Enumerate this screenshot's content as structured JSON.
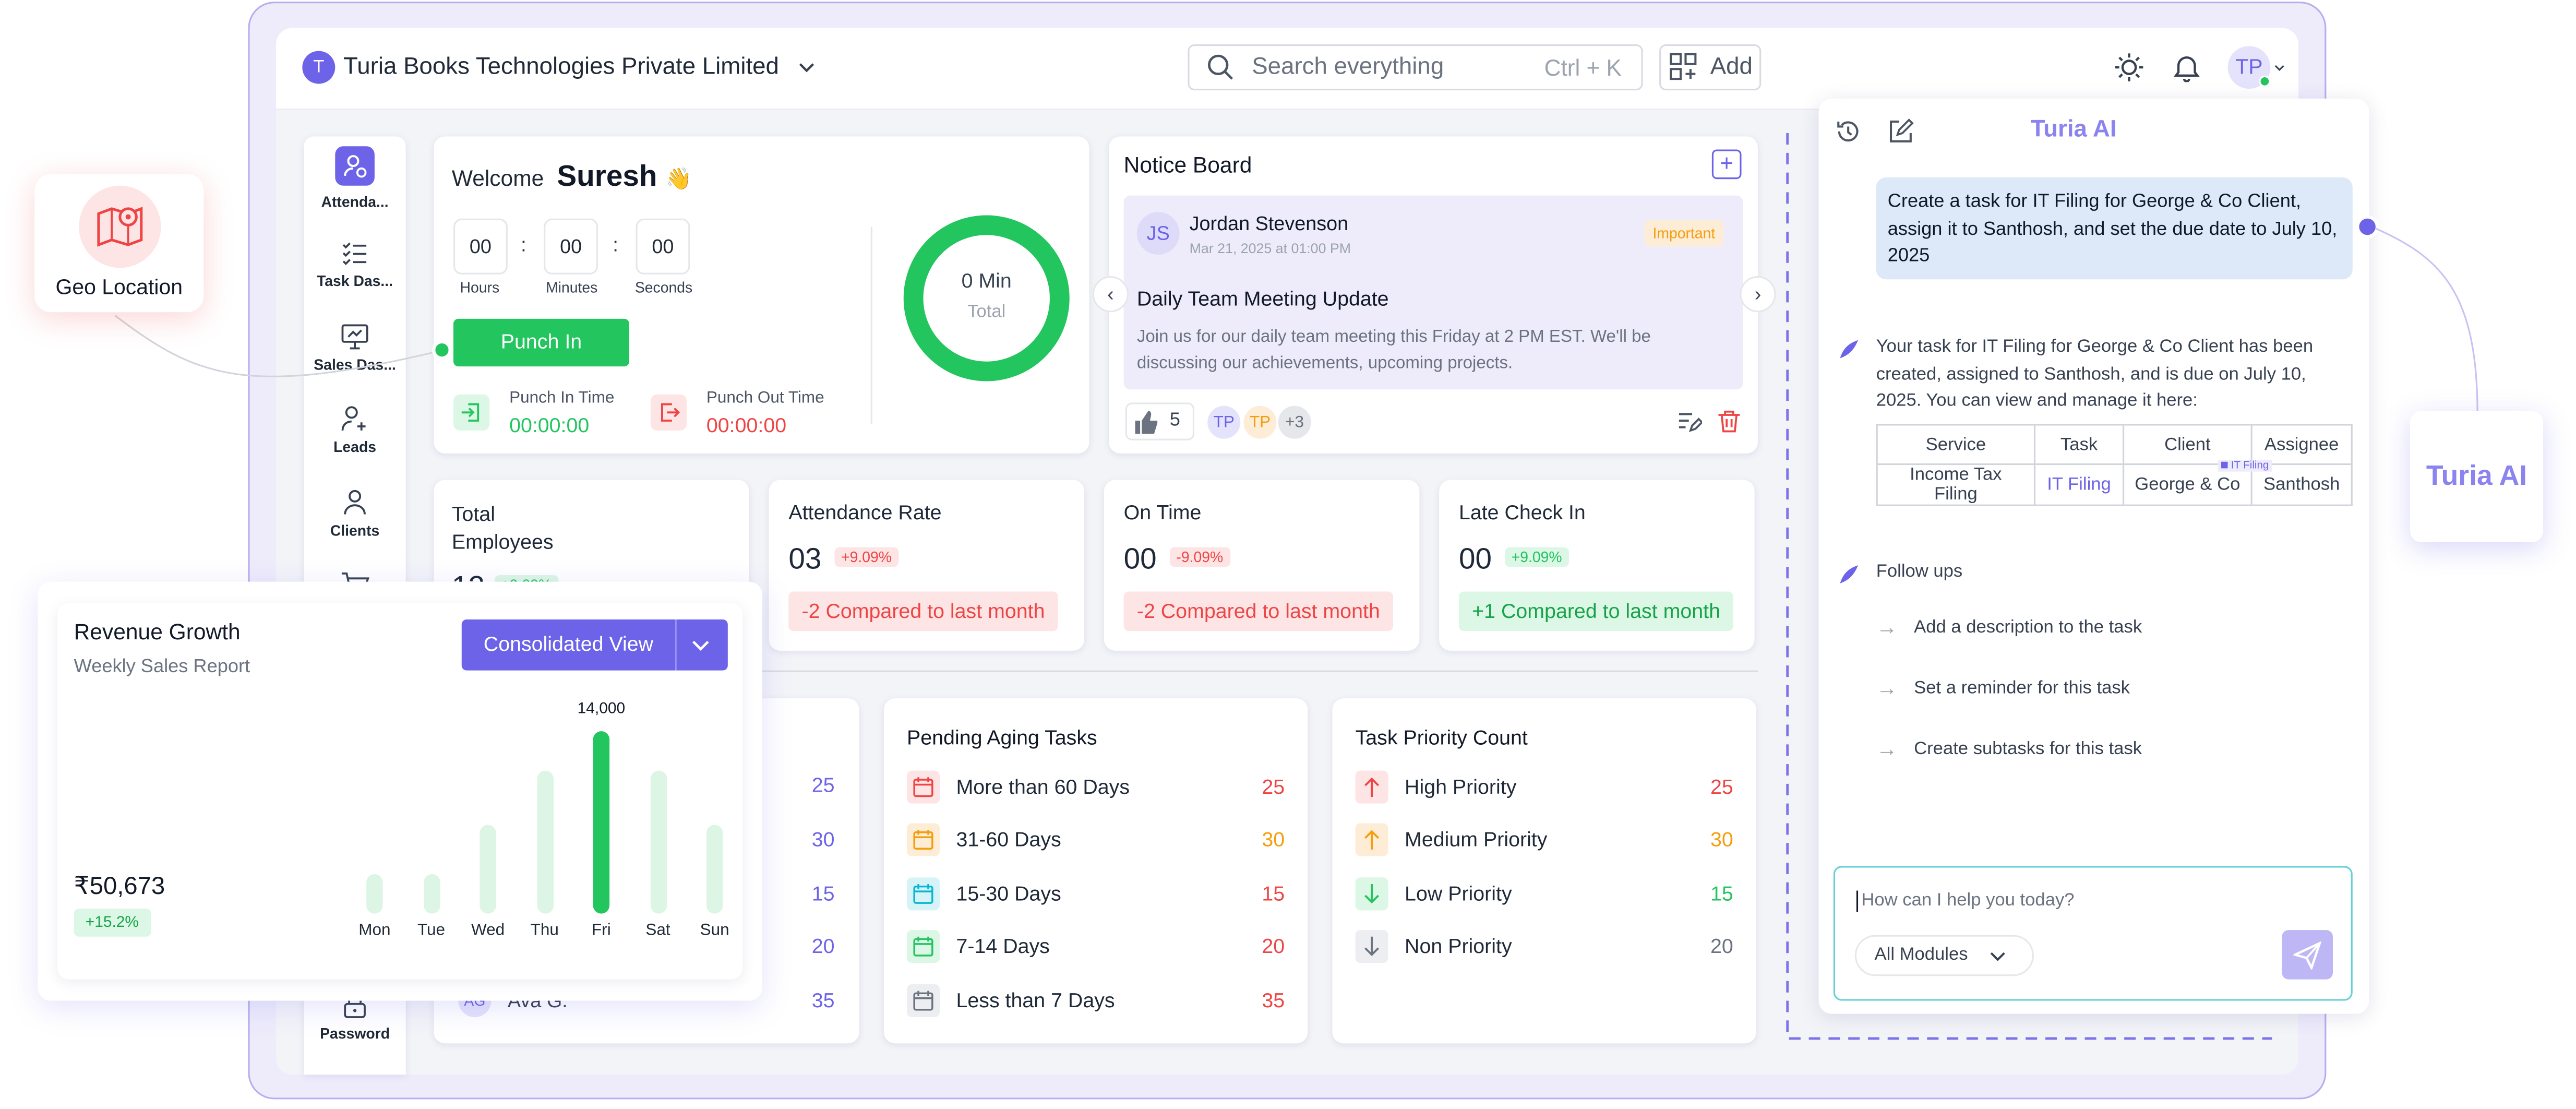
{
  "company": {
    "initial": "T",
    "name": "Turia Books Technologies Private Limited"
  },
  "search": {
    "placeholder": "Search everything",
    "shortcut": "Ctrl + K"
  },
  "add_label": "Add",
  "avatar_initials": "TP",
  "sidebar": {
    "items": [
      {
        "label": "Attenda...",
        "icon": "attendance-icon"
      },
      {
        "label": "Task Das...",
        "icon": "task-list-icon"
      },
      {
        "label": "Sales Das...",
        "icon": "monitor-icon"
      },
      {
        "label": "Leads",
        "icon": "user-plus-icon"
      },
      {
        "label": "Clients",
        "icon": "user-icon"
      },
      {
        "label": "Password",
        "icon": "lock-icon"
      }
    ]
  },
  "welcome": {
    "greeting": "Welcome",
    "name": "Suresh",
    "emoji": "👋",
    "time": {
      "hours": "00",
      "minutes": "00",
      "seconds": "00",
      "hours_label": "Hours",
      "minutes_label": "Minutes",
      "seconds_label": "Seconds"
    },
    "punch_button": "Punch In",
    "punch_in_label": "Punch In Time",
    "punch_in_value": "00:00:00",
    "punch_out_label": "Punch Out Time",
    "punch_out_value": "00:00:00",
    "ring_value": "0 Min",
    "ring_label": "Total"
  },
  "notice": {
    "title": "Notice Board",
    "author_initials": "JS",
    "author": "Jordan Stevenson",
    "date": "Mar 21, 2025 at 01:00 PM",
    "tag": "Important",
    "headline": "Daily Team Meeting Update",
    "body": "Join us for our daily team meeting this Friday at 2 PM EST. We'll be discussing our achievements, upcoming projects.",
    "likes": "5",
    "avatars": [
      "TP",
      "TP",
      "+3"
    ]
  },
  "stats": [
    {
      "title_1": "Total",
      "title_2": "Employees",
      "value": "12",
      "badge": "+9.09%"
    },
    {
      "title": "Attendance Rate",
      "value": "03",
      "badge": "+9.09%",
      "compare": "-2 Compared to last month"
    },
    {
      "title": "On Time",
      "value": "00",
      "badge": "-9.09%",
      "compare": "-2 Compared to last month"
    },
    {
      "title": "Late Check In",
      "value": "00",
      "badge": "+9.09%",
      "compare": "+1 Compared to last month"
    }
  ],
  "left_list": {
    "values": [
      "25",
      "30",
      "15",
      "20",
      "35"
    ],
    "last_initials": "AG",
    "last_name": "Ava G."
  },
  "aging": {
    "title": "Pending Aging Tasks",
    "rows": [
      {
        "label": "More than 60 Days",
        "value": "25",
        "color": "#ef4444"
      },
      {
        "label": "31-60 Days",
        "value": "30",
        "color": "#f59e0b"
      },
      {
        "label": "15-30 Days",
        "value": "15",
        "color": "#06b6d4"
      },
      {
        "label": "7-14 Days",
        "value": "20",
        "color": "#22c55e"
      },
      {
        "label": "Less than 7 Days",
        "value": "35",
        "color": "#6b7280"
      }
    ]
  },
  "priority": {
    "title": "Task Priority Count",
    "rows": [
      {
        "label": "High Priority",
        "value": "25",
        "color": "#ef4444"
      },
      {
        "label": "Medium Priority",
        "value": "30",
        "color": "#f59e0b"
      },
      {
        "label": "Low Priority",
        "value": "15",
        "color": "#22c55e"
      },
      {
        "label": "Non Priority",
        "value": "20",
        "color": "#6b7280"
      }
    ]
  },
  "geo_label": "Geo Location",
  "revenue": {
    "title": "Revenue Growth",
    "subtitle": "Weekly Sales Report",
    "button": "Consolidated View",
    "total": "₹50,673",
    "growth": "+15.2%",
    "peak_label": "14,000"
  },
  "chart_data": {
    "type": "bar",
    "categories": [
      "Mon",
      "Tue",
      "Wed",
      "Thu",
      "Fri",
      "Sat",
      "Sun"
    ],
    "values": [
      3000,
      3000,
      6800,
      11000,
      14000,
      11000,
      6800
    ],
    "highlight": "Fri",
    "highlight_color": "#22c55e",
    "bar_color": "#dcf5e4",
    "ylim": [
      0,
      14000
    ]
  },
  "ai": {
    "title": "Turia AI",
    "prompt": "Create a task for IT Filing for George & Co Client, assign it to Santhosh, and set the due date to July 10, 2025",
    "reply": "Your task for IT Filing for George & Co Client has been created, assigned to Santhosh, and is due on July 10, 2025. You can view and manage it here:",
    "table": {
      "headers": [
        "Service",
        "Task",
        "Client",
        "Assignee"
      ],
      "row": [
        "Income Tax Filing",
        "IT Filing",
        "George & Co",
        "Santhosh"
      ],
      "tag": "IT Filing"
    },
    "followups_title": "Follow ups",
    "followups": [
      "Add a description to the task",
      "Set a reminder for this task",
      "Create subtasks for this task"
    ],
    "input_placeholder": "How can I help you today?",
    "modules": "All Modules",
    "badge": "Turia AI"
  }
}
